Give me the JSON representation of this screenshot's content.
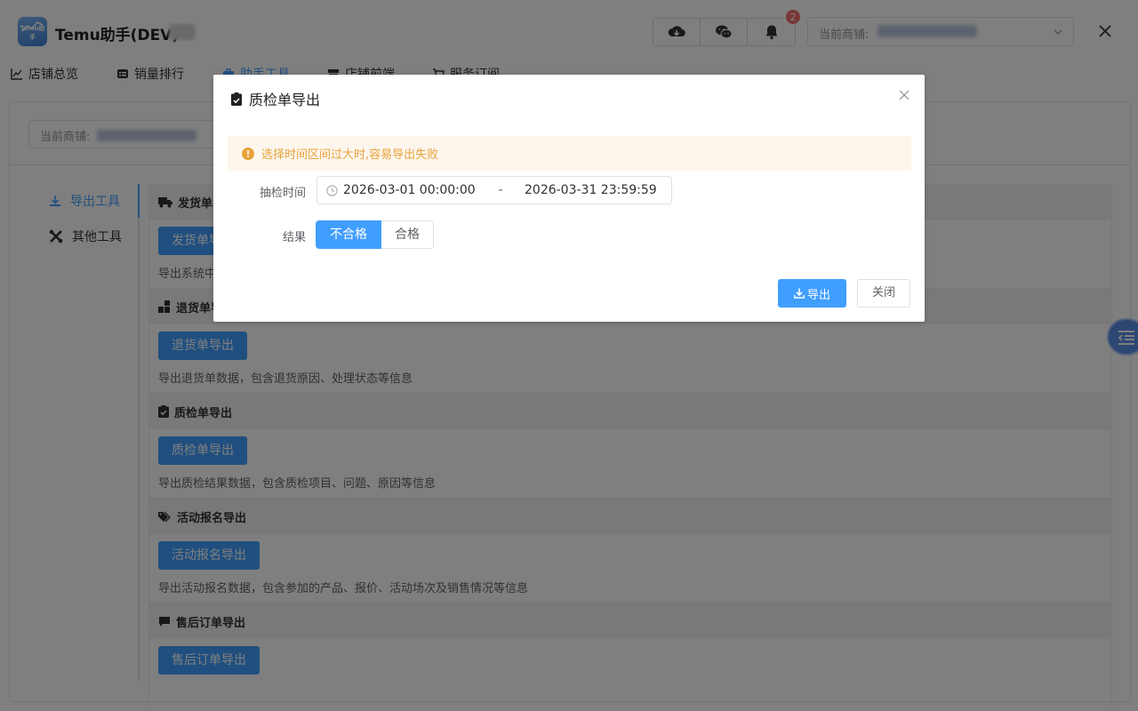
{
  "app": {
    "title": "Temu助手(DEV)",
    "logo_text": "Temu助手"
  },
  "header": {
    "icons": [
      "cloud-download-icon",
      "wechat-icon",
      "bell-icon"
    ],
    "notification_count": "2",
    "store_select_label": "当前商铺:"
  },
  "nav": {
    "tabs": [
      {
        "label": "店铺总览",
        "icon": "chart-line-icon"
      },
      {
        "label": "销量排行",
        "icon": "ranking-icon"
      },
      {
        "label": "助手工具",
        "icon": "toolbox-icon"
      },
      {
        "label": "店铺前端",
        "icon": "store-icon"
      },
      {
        "label": "服务订阅",
        "icon": "cart-icon"
      }
    ],
    "active": "助手工具"
  },
  "content": {
    "store_select_label": "当前商铺:",
    "side_menu": [
      {
        "label": "导出工具",
        "icon": "download-icon"
      },
      {
        "label": "其他工具",
        "icon": "tools-icon"
      }
    ],
    "sections": [
      {
        "title": "发货单导出",
        "button": "发货单导出",
        "desc": "导出系统中的发货单数据"
      },
      {
        "title": "退货单导出",
        "button": "退货单导出",
        "desc": "导出退货单数据，包含退货原因、处理状态等信息"
      },
      {
        "title": "质检单导出",
        "button": "质检单导出",
        "desc": "导出质检结果数据，包含质检项目、问题、原因等信息"
      },
      {
        "title": "活动报名导出",
        "button": "活动报名导出",
        "desc": "导出活动报名数据，包含参加的产品、报价、活动场次及销售情况等信息"
      },
      {
        "title": "售后订单导出",
        "button": "售后订单导出",
        "desc": ""
      }
    ]
  },
  "dialog": {
    "title": "质检单导出",
    "alert": "选择时间区间过大时,容易导出失败",
    "time_label": "抽检时间",
    "start": "2026-03-01 00:00:00",
    "separator": "-",
    "end": "2026-03-31 23:59:59",
    "result_label": "结果",
    "result_options": [
      "不合格",
      "合格"
    ],
    "result_selected": "不合格",
    "export_button": "导出",
    "close_button": "关闭"
  },
  "colors": {
    "primary": "#409eff",
    "warning": "#e6a23c",
    "danger": "#f56c6c"
  }
}
